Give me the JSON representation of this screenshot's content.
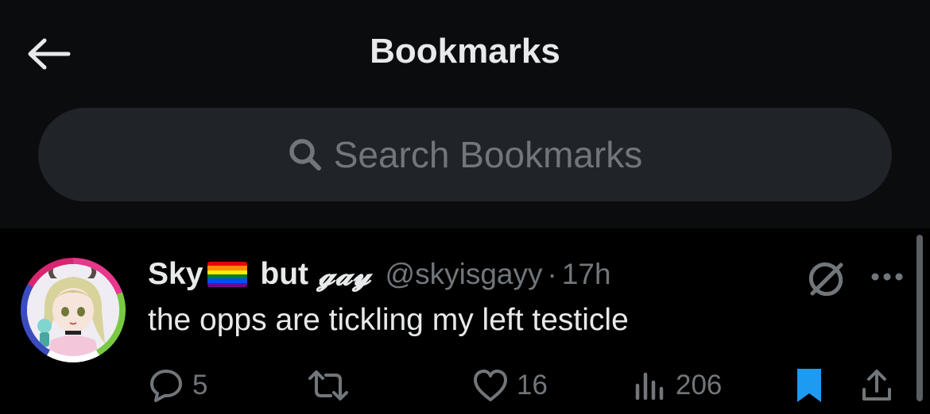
{
  "header": {
    "title": "Bookmarks",
    "back_icon": "arrow-left-icon"
  },
  "search": {
    "placeholder": "Search Bookmarks",
    "icon": "search-icon"
  },
  "tweet": {
    "display_name": "Sky",
    "display_name_suffix_plain": "but",
    "display_name_suffix_styled": "𝓰𝓪𝔂",
    "flag_emoji": "rainbow-flag",
    "handle": "@skyisgayy",
    "separator": "·",
    "time": "17h",
    "text": "the opps are tickling my left testicle",
    "actions": {
      "replies": "5",
      "retweets": "",
      "likes": "16",
      "views": "206",
      "bookmarked": true
    }
  },
  "colors": {
    "background": "#000000",
    "header_bg": "#0b0c0d",
    "search_bg": "#202327",
    "text_primary": "#e7e9ea",
    "text_secondary": "#71767b",
    "bookmark_active": "#1d9bf0"
  }
}
